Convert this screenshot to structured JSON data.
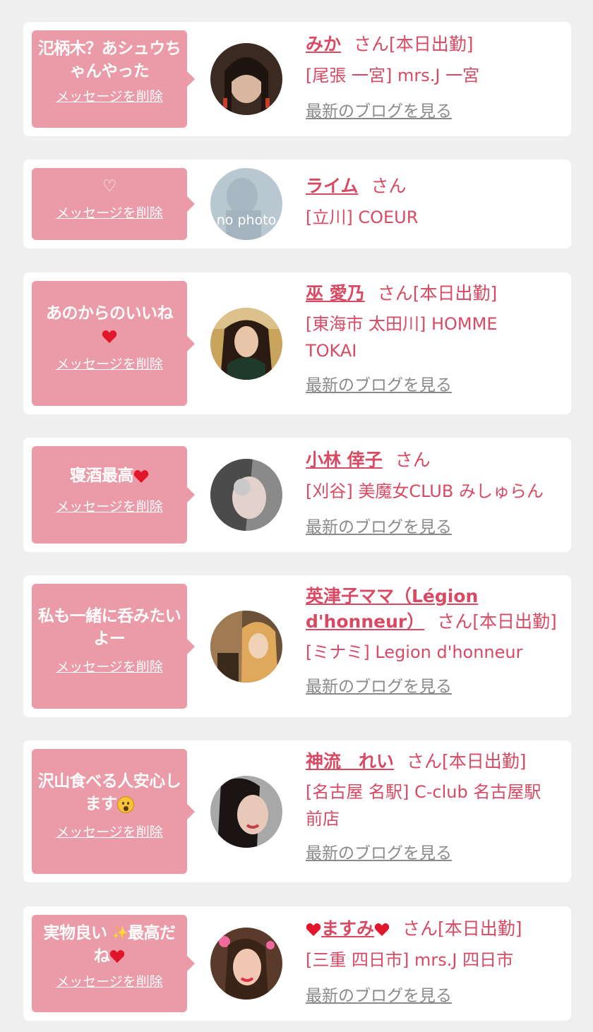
{
  "items": [
    {
      "message": "氾柄木？あシュウちゃんやった",
      "delete_label": "メッセージを削除",
      "name": "みか",
      "san": "さん",
      "status": "[本日出勤]",
      "shop": "[尾張 一宮] mrs.J 一宮",
      "blog": "最新のブログを見る"
    },
    {
      "message": "♡",
      "delete_label": "メッセージを削除",
      "name": "ライム",
      "san": "さん",
      "status": "",
      "shop": "[立川] COEUR",
      "photo_text": "no photo"
    },
    {
      "message": "あのからのいいね",
      "delete_label": "メッセージを削除",
      "name": "巫 愛乃",
      "san": "さん",
      "status": "[本日出勤]",
      "shop": "[東海市 太田川] HOMME TOKAI",
      "blog": "最新のブログを見る"
    },
    {
      "message": "寝酒最高",
      "delete_label": "メッセージを削除",
      "name": "小林 倖子",
      "san": "さん",
      "status": "",
      "shop": "[刈谷] 美魔女CLUB みしゅらん",
      "blog": "最新のブログを見る"
    },
    {
      "message": "私も一緒に呑みたいよー",
      "delete_label": "メッセージを削除",
      "name": "英津子ママ（Légion d'honneur）",
      "san": "さん",
      "status": "[本日出勤]",
      "shop": "[ミナミ] Legion d'honneur",
      "blog": "最新のブログを見る"
    },
    {
      "message": "沢山食べる人安心します",
      "delete_label": "メッセージを削除",
      "name": "神流　れい",
      "san": "さん",
      "status": "[本日出勤]",
      "shop": "[名古屋 名駅] C-club 名古屋駅前店",
      "blog": "最新のブログを見る"
    },
    {
      "message_a": "実物良い",
      "message_b": "最高だね",
      "delete_label": "メッセージを削除",
      "name": "ますみ",
      "san": "さん",
      "status": "[本日出勤]",
      "shop": "[三重 四日市] mrs.J 四日市",
      "blog": "最新のブログを見る"
    }
  ],
  "colors": {
    "bubble": "#eb9aa7",
    "name": "#d84a63",
    "link_gray": "#8a8a8a",
    "background": "#efefef"
  },
  "icons": [
    "heart-icon",
    "sparkle-icon",
    "surprised-face-icon"
  ]
}
